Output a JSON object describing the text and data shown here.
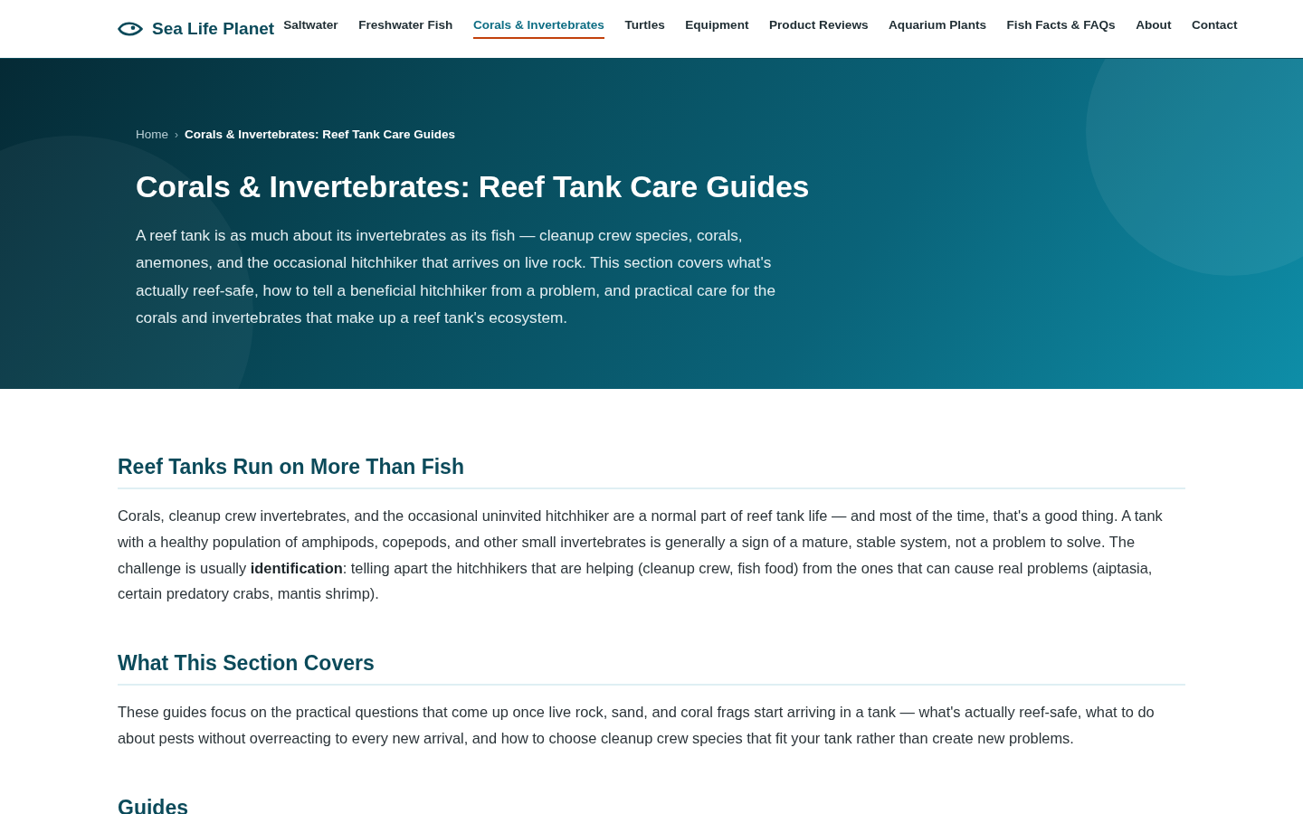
{
  "header": {
    "logo": {
      "name": "Sea Life Planet"
    },
    "nav": [
      {
        "label": "Saltwater",
        "selected": false
      },
      {
        "label": "Freshwater Fish",
        "selected": false
      },
      {
        "label": "Corals & Invertebrates",
        "selected": true
      },
      {
        "label": "Turtles",
        "selected": false
      },
      {
        "label": "Equipment",
        "selected": false
      },
      {
        "label": "Product Reviews",
        "selected": false
      },
      {
        "label": "Aquarium Plants",
        "selected": false
      },
      {
        "label": "Fish Facts & FAQs",
        "selected": false
      },
      {
        "label": "About",
        "selected": false
      },
      {
        "label": "Contact",
        "selected": false
      }
    ]
  },
  "hero": {
    "breadcrumb": [
      {
        "kind": "link",
        "label": "Home"
      },
      {
        "kind": "separator",
        "label": "›"
      },
      {
        "kind": "current",
        "label": "Corals & Invertebrates: Reef Tank Care Guides"
      }
    ],
    "title": "Corals & Invertebrates: Reef Tank Care Guides",
    "intro": "A reef tank is as much about its invertebrates as its fish — cleanup crew species, corals, anemones, and the occasional hitchhiker that arrives on live rock. This section covers what's actually reef-safe, how to tell a beneficial hitchhiker from a problem, and practical care for the corals and invertebrates that make up a reef tank's ecosystem."
  },
  "sections": [
    {
      "heading": "Reef Tanks Run on More Than Fish",
      "body": "Corals, cleanup crew invertebrates, and the occasional uninvited hitchhiker are a normal part of reef tank life — and most of the time, that's a good thing. A tank with a healthy population of amphipods, copepods, and other small invertebrates is generally a sign of a mature, stable system, not a problem to solve. The challenge is usually **identification**: telling apart the hitchhikers that are helping (cleanup crew, fish food) from the ones that can cause real problems (aiptasia, certain predatory crabs, mantis shrimp)."
    },
    {
      "heading": "What This Section Covers",
      "body": "These guides focus on the practical questions that come up once live rock, sand, and coral frags start arriving in a tank — what's actually reef-safe, what to do about pests without overreacting to every new arrival, and how to choose cleanup crew species that fit your tank rather than create new problems."
    },
    {
      "heading": "Guides"
    }
  ]
}
